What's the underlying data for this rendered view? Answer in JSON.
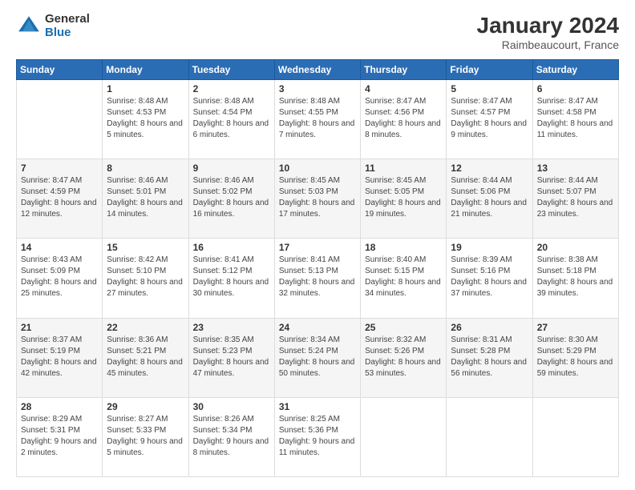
{
  "logo": {
    "general": "General",
    "blue": "Blue"
  },
  "title": "January 2024",
  "subtitle": "Raimbeaucourt, France",
  "days_of_week": [
    "Sunday",
    "Monday",
    "Tuesday",
    "Wednesday",
    "Thursday",
    "Friday",
    "Saturday"
  ],
  "weeks": [
    [
      {
        "day": "",
        "sunrise": "",
        "sunset": "",
        "daylight": ""
      },
      {
        "day": "1",
        "sunrise": "Sunrise: 8:48 AM",
        "sunset": "Sunset: 4:53 PM",
        "daylight": "Daylight: 8 hours and 5 minutes."
      },
      {
        "day": "2",
        "sunrise": "Sunrise: 8:48 AM",
        "sunset": "Sunset: 4:54 PM",
        "daylight": "Daylight: 8 hours and 6 minutes."
      },
      {
        "day": "3",
        "sunrise": "Sunrise: 8:48 AM",
        "sunset": "Sunset: 4:55 PM",
        "daylight": "Daylight: 8 hours and 7 minutes."
      },
      {
        "day": "4",
        "sunrise": "Sunrise: 8:47 AM",
        "sunset": "Sunset: 4:56 PM",
        "daylight": "Daylight: 8 hours and 8 minutes."
      },
      {
        "day": "5",
        "sunrise": "Sunrise: 8:47 AM",
        "sunset": "Sunset: 4:57 PM",
        "daylight": "Daylight: 8 hours and 9 minutes."
      },
      {
        "day": "6",
        "sunrise": "Sunrise: 8:47 AM",
        "sunset": "Sunset: 4:58 PM",
        "daylight": "Daylight: 8 hours and 11 minutes."
      }
    ],
    [
      {
        "day": "7",
        "sunrise": "Sunrise: 8:47 AM",
        "sunset": "Sunset: 4:59 PM",
        "daylight": "Daylight: 8 hours and 12 minutes."
      },
      {
        "day": "8",
        "sunrise": "Sunrise: 8:46 AM",
        "sunset": "Sunset: 5:01 PM",
        "daylight": "Daylight: 8 hours and 14 minutes."
      },
      {
        "day": "9",
        "sunrise": "Sunrise: 8:46 AM",
        "sunset": "Sunset: 5:02 PM",
        "daylight": "Daylight: 8 hours and 16 minutes."
      },
      {
        "day": "10",
        "sunrise": "Sunrise: 8:45 AM",
        "sunset": "Sunset: 5:03 PM",
        "daylight": "Daylight: 8 hours and 17 minutes."
      },
      {
        "day": "11",
        "sunrise": "Sunrise: 8:45 AM",
        "sunset": "Sunset: 5:05 PM",
        "daylight": "Daylight: 8 hours and 19 minutes."
      },
      {
        "day": "12",
        "sunrise": "Sunrise: 8:44 AM",
        "sunset": "Sunset: 5:06 PM",
        "daylight": "Daylight: 8 hours and 21 minutes."
      },
      {
        "day": "13",
        "sunrise": "Sunrise: 8:44 AM",
        "sunset": "Sunset: 5:07 PM",
        "daylight": "Daylight: 8 hours and 23 minutes."
      }
    ],
    [
      {
        "day": "14",
        "sunrise": "Sunrise: 8:43 AM",
        "sunset": "Sunset: 5:09 PM",
        "daylight": "Daylight: 8 hours and 25 minutes."
      },
      {
        "day": "15",
        "sunrise": "Sunrise: 8:42 AM",
        "sunset": "Sunset: 5:10 PM",
        "daylight": "Daylight: 8 hours and 27 minutes."
      },
      {
        "day": "16",
        "sunrise": "Sunrise: 8:41 AM",
        "sunset": "Sunset: 5:12 PM",
        "daylight": "Daylight: 8 hours and 30 minutes."
      },
      {
        "day": "17",
        "sunrise": "Sunrise: 8:41 AM",
        "sunset": "Sunset: 5:13 PM",
        "daylight": "Daylight: 8 hours and 32 minutes."
      },
      {
        "day": "18",
        "sunrise": "Sunrise: 8:40 AM",
        "sunset": "Sunset: 5:15 PM",
        "daylight": "Daylight: 8 hours and 34 minutes."
      },
      {
        "day": "19",
        "sunrise": "Sunrise: 8:39 AM",
        "sunset": "Sunset: 5:16 PM",
        "daylight": "Daylight: 8 hours and 37 minutes."
      },
      {
        "day": "20",
        "sunrise": "Sunrise: 8:38 AM",
        "sunset": "Sunset: 5:18 PM",
        "daylight": "Daylight: 8 hours and 39 minutes."
      }
    ],
    [
      {
        "day": "21",
        "sunrise": "Sunrise: 8:37 AM",
        "sunset": "Sunset: 5:19 PM",
        "daylight": "Daylight: 8 hours and 42 minutes."
      },
      {
        "day": "22",
        "sunrise": "Sunrise: 8:36 AM",
        "sunset": "Sunset: 5:21 PM",
        "daylight": "Daylight: 8 hours and 45 minutes."
      },
      {
        "day": "23",
        "sunrise": "Sunrise: 8:35 AM",
        "sunset": "Sunset: 5:23 PM",
        "daylight": "Daylight: 8 hours and 47 minutes."
      },
      {
        "day": "24",
        "sunrise": "Sunrise: 8:34 AM",
        "sunset": "Sunset: 5:24 PM",
        "daylight": "Daylight: 8 hours and 50 minutes."
      },
      {
        "day": "25",
        "sunrise": "Sunrise: 8:32 AM",
        "sunset": "Sunset: 5:26 PM",
        "daylight": "Daylight: 8 hours and 53 minutes."
      },
      {
        "day": "26",
        "sunrise": "Sunrise: 8:31 AM",
        "sunset": "Sunset: 5:28 PM",
        "daylight": "Daylight: 8 hours and 56 minutes."
      },
      {
        "day": "27",
        "sunrise": "Sunrise: 8:30 AM",
        "sunset": "Sunset: 5:29 PM",
        "daylight": "Daylight: 8 hours and 59 minutes."
      }
    ],
    [
      {
        "day": "28",
        "sunrise": "Sunrise: 8:29 AM",
        "sunset": "Sunset: 5:31 PM",
        "daylight": "Daylight: 9 hours and 2 minutes."
      },
      {
        "day": "29",
        "sunrise": "Sunrise: 8:27 AM",
        "sunset": "Sunset: 5:33 PM",
        "daylight": "Daylight: 9 hours and 5 minutes."
      },
      {
        "day": "30",
        "sunrise": "Sunrise: 8:26 AM",
        "sunset": "Sunset: 5:34 PM",
        "daylight": "Daylight: 9 hours and 8 minutes."
      },
      {
        "day": "31",
        "sunrise": "Sunrise: 8:25 AM",
        "sunset": "Sunset: 5:36 PM",
        "daylight": "Daylight: 9 hours and 11 minutes."
      },
      {
        "day": "",
        "sunrise": "",
        "sunset": "",
        "daylight": ""
      },
      {
        "day": "",
        "sunrise": "",
        "sunset": "",
        "daylight": ""
      },
      {
        "day": "",
        "sunrise": "",
        "sunset": "",
        "daylight": ""
      }
    ]
  ]
}
